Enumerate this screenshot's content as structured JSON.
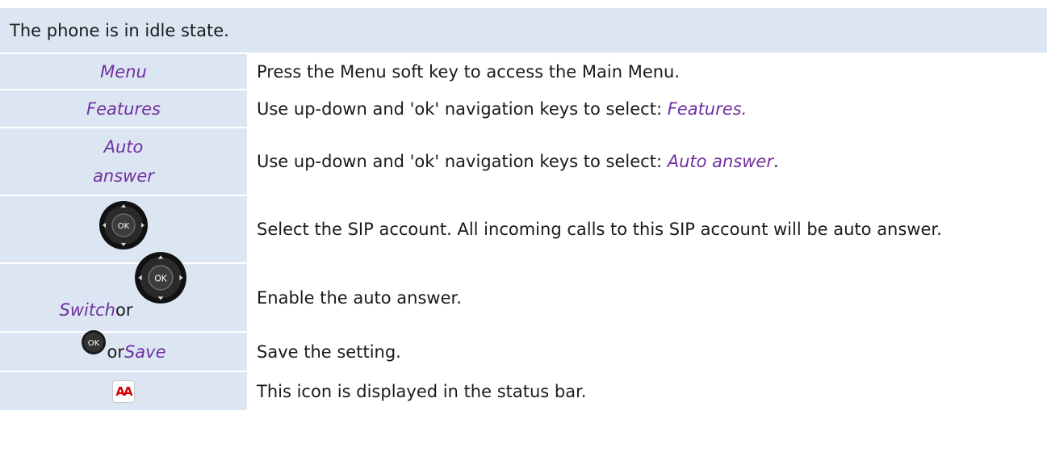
{
  "header": "The phone is in idle state.",
  "rows": [
    {
      "left": "Menu",
      "right": "Press the Menu soft key to access the Main Menu."
    },
    {
      "left": "Features",
      "right_prefix": "Use up-down and 'ok' navigation keys to select: ",
      "right_emph": "Features."
    },
    {
      "left_line1": "Auto",
      "left_line2": "answer",
      "right_prefix": "Use up-down and 'ok' navigation keys to select: ",
      "right_emph": "Auto answer",
      "right_suffix": "."
    },
    {
      "left_icon": "navigation-ok-key-icon",
      "right": "Select the SIP account. All incoming calls to this SIP account will be auto answer."
    },
    {
      "left_emph": "Switch",
      "left_plain": " or",
      "left_icon": "navigation-ok-key-icon",
      "right": "Enable the auto answer."
    },
    {
      "left_icon": "ok-button-icon",
      "left_plain": "or ",
      "left_emph": "Save",
      "right": "Save the setting."
    },
    {
      "left_icon": "auto-answer-status-icon",
      "left_icon_text": "AA",
      "right": "This icon is displayed in the status bar."
    }
  ],
  "colors": {
    "row_bg": "#dce6f2",
    "emphasis": "#7030a0",
    "status_icon": "#d40000"
  }
}
